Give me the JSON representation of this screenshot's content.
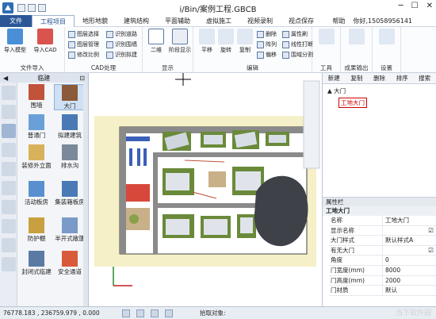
{
  "title": "i/Bin/案例工程.GBCB",
  "menu": {
    "file": "文件",
    "tabs": [
      "工程项目",
      "地形地貌",
      "建筑结构",
      "平面辅助",
      "虚拟施工",
      "视频录制",
      "视点保存"
    ],
    "help": "帮助",
    "user": "你好,15058956141"
  },
  "ribbon": {
    "import_model": "导入模型",
    "import_cad": "导入CAD",
    "group_file_import": "文件导入",
    "cad_items": [
      "图层选择",
      "识别道路",
      "图层管理",
      "识别围墙",
      "修改比例",
      "识别拟建"
    ],
    "group_cad": "CAD处理",
    "display_items": [
      "二维",
      "阶段显示"
    ],
    "group_display": "显示",
    "edit_items": [
      "平移",
      "旋转",
      "复制",
      "删除",
      "属性刷",
      "阵列",
      "线性打断",
      "偏移",
      "围域分割"
    ],
    "group_edit": "编辑",
    "tools": [
      "工具",
      "成果输出",
      "设置"
    ]
  },
  "left_panel": {
    "title": "临建",
    "items": [
      "围墙",
      "大门",
      "普通门",
      "拟建建筑",
      "装修外立面",
      "排水沟",
      "活动板房",
      "集装箱板房",
      "防护棚",
      "半开式敞篷",
      "封闭式临建",
      "安全通道"
    ]
  },
  "right_panel": {
    "tabs": [
      "新建",
      "复制",
      "删除",
      "排序",
      "搜索"
    ],
    "tree_root": "大门",
    "tree_child": "工地大门",
    "props_header": "属性栏",
    "props_title": "工地大门",
    "props": [
      {
        "key": "名称",
        "value": "工地大门"
      },
      {
        "key": "显示名称",
        "value": "☑"
      },
      {
        "key": "大门样式",
        "value": "默认样式A"
      },
      {
        "key": "有无大门",
        "value": "☑"
      },
      {
        "key": "角度",
        "value": "0"
      },
      {
        "key": "门宽度(mm)",
        "value": "8000"
      },
      {
        "key": "门高度(mm)",
        "value": "2000"
      },
      {
        "key": "门材质",
        "value": "默认"
      }
    ]
  },
  "status": {
    "coords": "76778.183 , 236759.979 , 0.000",
    "prompt": "拾取对象:"
  },
  "watermark": "当下软件园"
}
